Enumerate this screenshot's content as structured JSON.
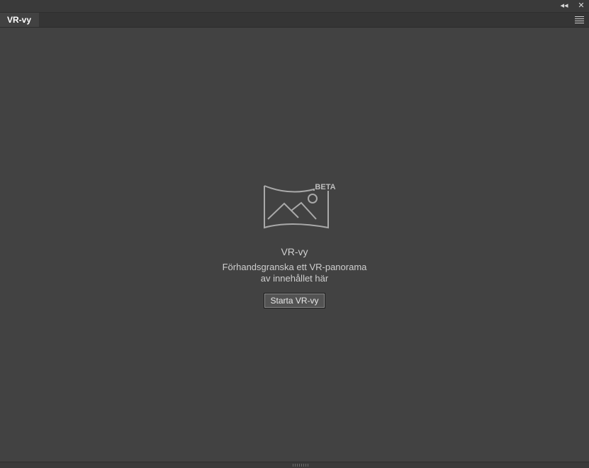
{
  "panel": {
    "tab_label": "VR-vy",
    "collapse_glyph": "◂◂",
    "close_glyph": "✕"
  },
  "empty_state": {
    "badge": "BETA",
    "title": "VR-vy",
    "description_line1": "Förhandsgranska ett VR-panorama",
    "description_line2": "av innehållet här",
    "start_button": "Starta VR-vy"
  },
  "icons": {
    "collapse": "double-left-arrow-icon",
    "close": "close-icon",
    "menu": "panel-menu-icon",
    "vr": "vr-panorama-icon"
  }
}
